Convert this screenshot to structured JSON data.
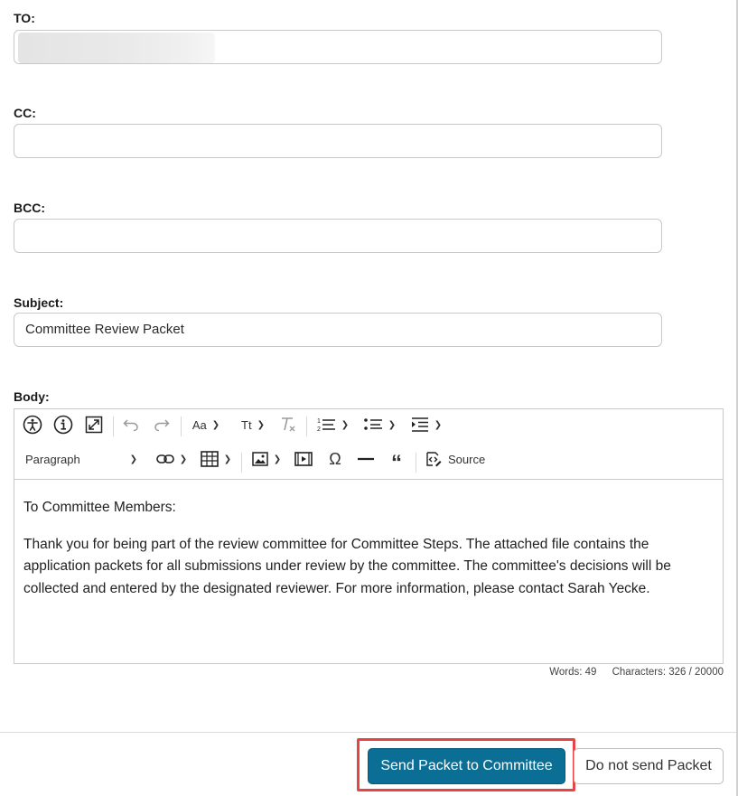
{
  "fields": {
    "to": {
      "label": "TO:",
      "value": ""
    },
    "cc": {
      "label": "CC:",
      "value": ""
    },
    "bcc": {
      "label": "BCC:",
      "value": ""
    },
    "subject": {
      "label": "Subject:",
      "value": "Committee Review Packet"
    },
    "body": {
      "label": "Body:"
    }
  },
  "toolbar": {
    "row1": [
      "accessibility-icon",
      "info-icon",
      "maximize-icon",
      "undo-icon",
      "redo-icon",
      "font-size-icon",
      "text-transform-icon",
      "remove-format-icon",
      "numbered-list-icon",
      "bulleted-list-icon",
      "indent-icon"
    ],
    "font_size_label": "Aa",
    "text_transform_label": "Tt",
    "heading_select": "Paragraph",
    "source_label": "Source"
  },
  "editor": {
    "paragraphs": [
      "To Committee Members:",
      "Thank you for being part of the review committee for Committee Steps. The attached file contains the application packets for all submissions under review by the committee. The committee's decisions will be collected and entered by the designated reviewer. For more information, please contact Sarah Yecke."
    ],
    "words": "Words: 49",
    "characters": "Characters: 326 / 20000"
  },
  "actions": {
    "send_label": "Send Packet to Committee",
    "cancel_label": "Do not send Packet"
  },
  "colors": {
    "primary": "#0a6e95",
    "highlight": "#e54545"
  }
}
